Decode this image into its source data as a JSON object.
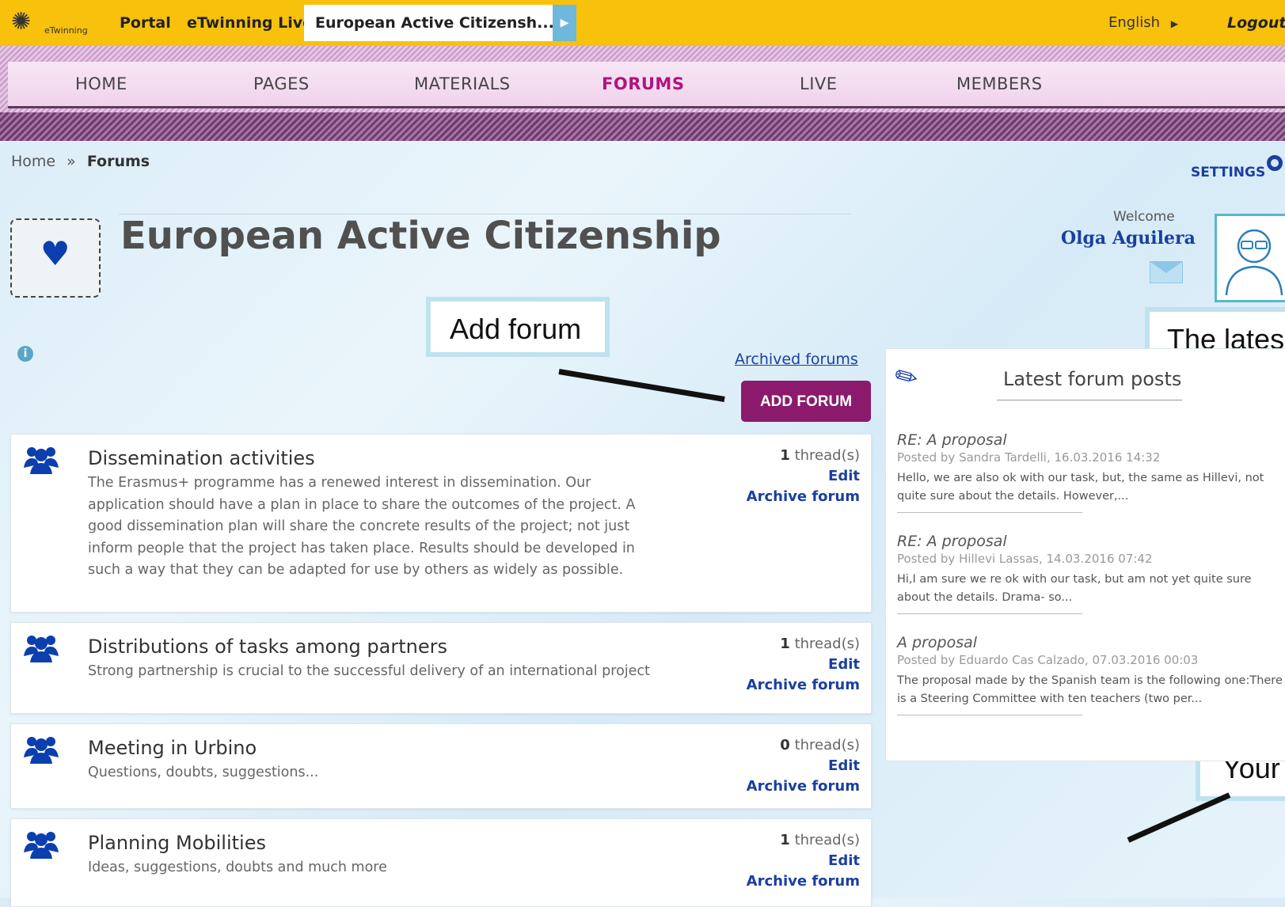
{
  "topbar": {
    "logo_text": "eTwinning",
    "links": [
      "Portal",
      "eTwinning Live"
    ],
    "active_tab": "European Active Citizensh...",
    "language": "English",
    "language_arrow": "▶",
    "logout": "Logout"
  },
  "nav": [
    "HOME",
    "PAGES",
    "MATERIALS",
    "FORUMS",
    "LIVE",
    "MEMBERS"
  ],
  "breadcrumb": {
    "home": "Home",
    "sep": "»",
    "current": "Forums"
  },
  "settings": "SETTINGS",
  "page_title": "European Active Citizenship",
  "user": {
    "welcome": "Welcome",
    "name": "Olga Aguilera"
  },
  "callouts": {
    "add_forum": "Add forum",
    "latest": "The lates",
    "your": "Your"
  },
  "archived_link": "Archived forums",
  "add_forum_button": "ADD FORUM",
  "forums": [
    {
      "name": "Dissemination activities",
      "description": "The Erasmus+ programme has a renewed interest in dissemination. Our application should have a plan in place to share the outcomes of the project. A good dissemination plan will share the concrete results of the project; not just inform people that the project has taken place. Results should be developed in such a way that they can be adapted for use by others as widely as possible.",
      "thread_count": "1",
      "threads_label": "thread(s)",
      "edit": "Edit",
      "archive": "Archive forum"
    },
    {
      "name": "Distributions of tasks among partners",
      "description": "Strong partnership is crucial to the successful delivery of an international project",
      "thread_count": "1",
      "threads_label": "thread(s)",
      "edit": "Edit",
      "archive": "Archive forum"
    },
    {
      "name": "Meeting in Urbino",
      "description": "Questions, doubts, suggestions...",
      "thread_count": "0",
      "threads_label": "thread(s)",
      "edit": "Edit",
      "archive": "Archive forum"
    },
    {
      "name": "Planning Mobilities",
      "description": "Ideas, suggestions, doubts and much more",
      "thread_count": "1",
      "threads_label": "thread(s)",
      "edit": "Edit",
      "archive": "Archive forum"
    }
  ],
  "latest_posts": {
    "title": "Latest forum posts",
    "posts": [
      {
        "title": "RE: A proposal",
        "meta": "Posted by Sandra Tardelli, 16.03.2016 14:32",
        "text": "Hello, we are also ok with our task, but, the same as Hillevi, not quite sure about the details. However,..."
      },
      {
        "title": "RE: A proposal",
        "meta": "Posted by Hillevi Lassas, 14.03.2016 07:42",
        "text": "Hi,I am sure we re ok with our task, but am not yet quite sure about the details. Drama- so..."
      },
      {
        "title": "A proposal",
        "meta": "Posted by Eduardo Cas Calzado, 07.03.2016 00:03",
        "text": "The proposal made by the Spanish team is the following one:There is a Steering Committee with ten teachers (two per..."
      }
    ]
  },
  "colors": {
    "topbar": "#f8c10b",
    "accent": "#8b1a6d",
    "link": "#1a3fa0",
    "active_nav": "#b0147c"
  }
}
